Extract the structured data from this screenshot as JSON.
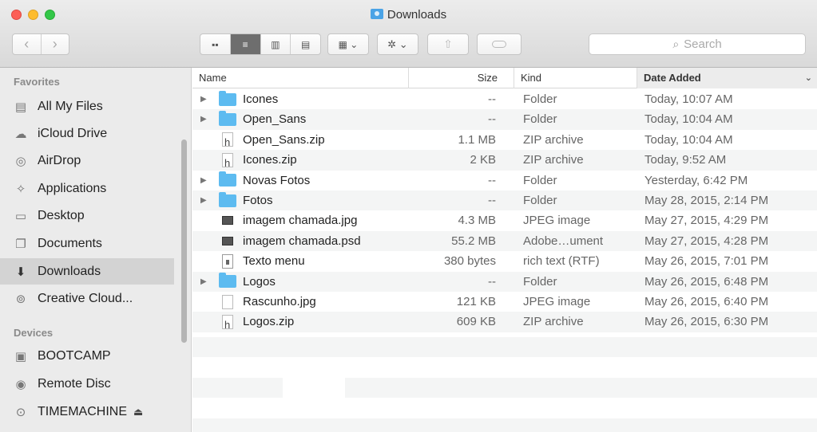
{
  "window": {
    "title": "Downloads"
  },
  "toolbar": {
    "back": "‹",
    "forward": "›",
    "views": [
      "▪▪",
      "≡",
      "▥",
      "▤"
    ],
    "arrange": "▦ ⌄",
    "action": "✲ ⌄",
    "share": "⇧",
    "search_placeholder": "Search",
    "search_icon": "⌕"
  },
  "sidebar": {
    "favorites_label": "Favorites",
    "devices_label": "Devices",
    "favorites": [
      {
        "label": "All My Files",
        "icon": "▤",
        "selected": false
      },
      {
        "label": "iCloud Drive",
        "icon": "☁",
        "selected": false
      },
      {
        "label": "AirDrop",
        "icon": "◎",
        "selected": false
      },
      {
        "label": "Applications",
        "icon": "✧",
        "selected": false
      },
      {
        "label": "Desktop",
        "icon": "▭",
        "selected": false
      },
      {
        "label": "Documents",
        "icon": "❐",
        "selected": false
      },
      {
        "label": "Downloads",
        "icon": "⬇",
        "selected": true
      },
      {
        "label": "Creative Cloud...",
        "icon": "⊚",
        "selected": false
      }
    ],
    "devices": [
      {
        "label": "BOOTCAMP",
        "icon": "▣"
      },
      {
        "label": "Remote Disc",
        "icon": "◉"
      },
      {
        "label": "TIMEMACHINE",
        "icon": "⊙",
        "eject": "⏏"
      }
    ]
  },
  "columns": {
    "name": "Name",
    "size": "Size",
    "kind": "Kind",
    "date": "Date Added",
    "sort_chevron": "⌄"
  },
  "files": [
    {
      "type": "folder",
      "name": "Icones",
      "size": "--",
      "kind": "Folder",
      "date": "Today, 10:07 AM",
      "expand": "▶"
    },
    {
      "type": "folder",
      "name": "Open_Sans",
      "size": "--",
      "kind": "Folder",
      "date": "Today, 10:04 AM",
      "expand": "▶"
    },
    {
      "type": "zip",
      "name": "Open_Sans.zip",
      "size": "1.1 MB",
      "kind": "ZIP archive",
      "date": "Today, 10:04 AM",
      "expand": ""
    },
    {
      "type": "zip",
      "name": "Icones.zip",
      "size": "2 KB",
      "kind": "ZIP archive",
      "date": "Today, 9:52 AM",
      "expand": ""
    },
    {
      "type": "folder",
      "name": "Novas Fotos",
      "size": "--",
      "kind": "Folder",
      "date": "Yesterday, 6:42 PM",
      "expand": "▶"
    },
    {
      "type": "folder",
      "name": "Fotos",
      "size": "--",
      "kind": "Folder",
      "date": "May 28, 2015, 2:14 PM",
      "expand": "▶"
    },
    {
      "type": "image",
      "name": "imagem chamada.jpg",
      "size": "4.3 MB",
      "kind": "JPEG image",
      "date": "May 27, 2015, 4:29 PM",
      "expand": ""
    },
    {
      "type": "image",
      "name": "imagem chamada.psd",
      "size": "55.2 MB",
      "kind": "Adobe…ument",
      "date": "May 27, 2015, 4:28 PM",
      "expand": ""
    },
    {
      "type": "rtf",
      "name": "Texto menu",
      "size": "380 bytes",
      "kind": "rich text (RTF)",
      "date": "May 26, 2015, 7:01 PM",
      "expand": ""
    },
    {
      "type": "folder",
      "name": "Logos",
      "size": "--",
      "kind": "Folder",
      "date": "May 26, 2015, 6:48 PM",
      "expand": "▶"
    },
    {
      "type": "file",
      "name": "Rascunho.jpg",
      "size": "121 KB",
      "kind": "JPEG image",
      "date": "May 26, 2015, 6:40 PM",
      "expand": ""
    },
    {
      "type": "zip",
      "name": "Logos.zip",
      "size": "609 KB",
      "kind": "ZIP archive",
      "date": "May 26, 2015, 6:30 PM",
      "expand": ""
    }
  ]
}
